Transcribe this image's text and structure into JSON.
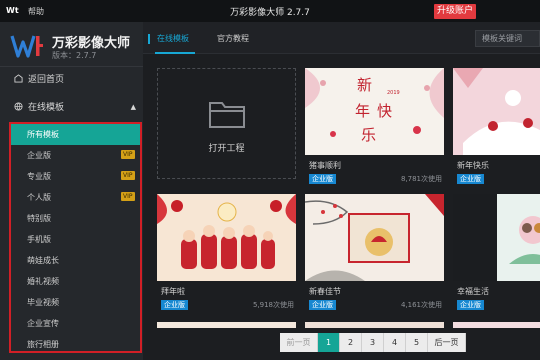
{
  "titlebar": {
    "logo": "Wt",
    "help": "帮助",
    "title": "万彩影像大师 2.7.7",
    "upgrade": "升级账户"
  },
  "brand": {
    "name": "万彩影像大师",
    "version": "版本：2.7.7"
  },
  "nav": {
    "home": "返回首页",
    "online": "在线模板"
  },
  "categories": [
    {
      "label": "所有模板",
      "vip": ""
    },
    {
      "label": "企业版",
      "vip": "VIP"
    },
    {
      "label": "专业版",
      "vip": "VIP"
    },
    {
      "label": "个人版",
      "vip": "VIP"
    },
    {
      "label": "特别版",
      "vip": ""
    },
    {
      "label": "手机版",
      "vip": ""
    },
    {
      "label": "萌娃成长",
      "vip": ""
    },
    {
      "label": "婚礼视频",
      "vip": ""
    },
    {
      "label": "毕业视频",
      "vip": ""
    },
    {
      "label": "企业宣传",
      "vip": ""
    },
    {
      "label": "旅行相册",
      "vip": ""
    }
  ],
  "tabs": {
    "online": "在线模板",
    "official": "官方教程"
  },
  "search": {
    "placeholder": "模板关键词"
  },
  "open_project": "打开工程",
  "cards": [
    {
      "name": "猪事顺利",
      "badge": "企业版",
      "uses": "8,781次使用",
      "art": "新年乐 2019"
    },
    {
      "name": "新年快乐",
      "badge": "企业版",
      "uses": ""
    },
    {
      "name": "拜年啦",
      "badge": "企业版",
      "uses": "5,918次使用"
    },
    {
      "name": "新春佳节",
      "badge": "企业版",
      "uses": "4,161次使用"
    },
    {
      "name": "幸福生活",
      "badge": "企业版",
      "uses": ""
    }
  ],
  "pagination": {
    "prev": "前一页",
    "pages": [
      "1",
      "2",
      "3",
      "4",
      "5"
    ],
    "next": "后一页",
    "current": "1"
  }
}
